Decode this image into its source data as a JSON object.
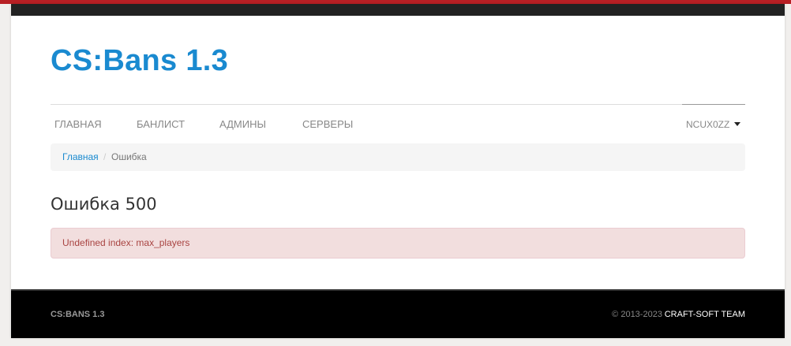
{
  "header": {
    "logo": "CS:Bans 1.3"
  },
  "nav": {
    "items": [
      {
        "label": "ГЛАВНАЯ"
      },
      {
        "label": "БАНЛИСТ"
      },
      {
        "label": "АДМИНЫ"
      },
      {
        "label": "СЕРВЕРЫ"
      }
    ],
    "user": "NCUX0ZZ"
  },
  "breadcrumb": {
    "home": "Главная",
    "separator": "/",
    "current": "Ошибка"
  },
  "error": {
    "title": "Ошибка 500",
    "message": "Undefined index: max_players"
  },
  "footer": {
    "brand": "CS:BANS 1.3",
    "copyright": "© 2013-2023",
    "team": "CRAFT-SOFT TEAM"
  },
  "colors": {
    "accent": "#1a8ad0",
    "top_stripe": "#b81f24",
    "alert_bg": "#f2dede",
    "alert_text": "#a94442",
    "footer_bg": "#000000"
  }
}
